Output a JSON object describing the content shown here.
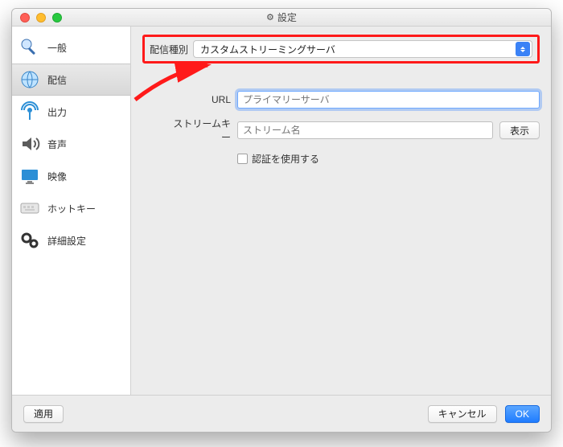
{
  "window": {
    "title": "設定"
  },
  "sidebar": {
    "items": [
      {
        "label": "一般"
      },
      {
        "label": "配信"
      },
      {
        "label": "出力"
      },
      {
        "label": "音声"
      },
      {
        "label": "映像"
      },
      {
        "label": "ホットキー"
      },
      {
        "label": "詳細設定"
      }
    ]
  },
  "stream": {
    "type_label": "配信種別",
    "type_value": "カスタムストリーミングサーバ",
    "url_label": "URL",
    "url_placeholder": "プライマリーサーバ",
    "key_label": "ストリームキー",
    "key_placeholder": "ストリーム名",
    "show_button": "表示",
    "auth_label": "認証を使用する"
  },
  "footer": {
    "apply": "適用",
    "cancel": "キャンセル",
    "ok": "OK"
  }
}
